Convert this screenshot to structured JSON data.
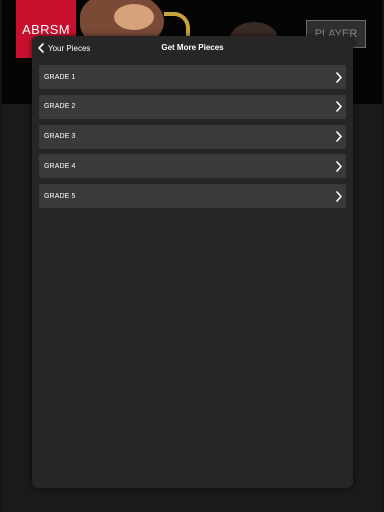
{
  "banner": {
    "logo_text": "ABRSM",
    "player_label": "PLAYER"
  },
  "header": {
    "back_label": "Your Pieces",
    "title": "Get More Pieces"
  },
  "grades": [
    {
      "label": "GRADE 1"
    },
    {
      "label": "GRADE 2"
    },
    {
      "label": "GRADE 3"
    },
    {
      "label": "GRADE 4"
    },
    {
      "label": "GRADE 5"
    }
  ],
  "colors": {
    "logo_red": "#c8102e",
    "panel_bg": "#262626",
    "row_bg": "#3a3a3a"
  },
  "icons": {
    "back": "chevron-left-icon",
    "row": "chevron-right-icon"
  }
}
